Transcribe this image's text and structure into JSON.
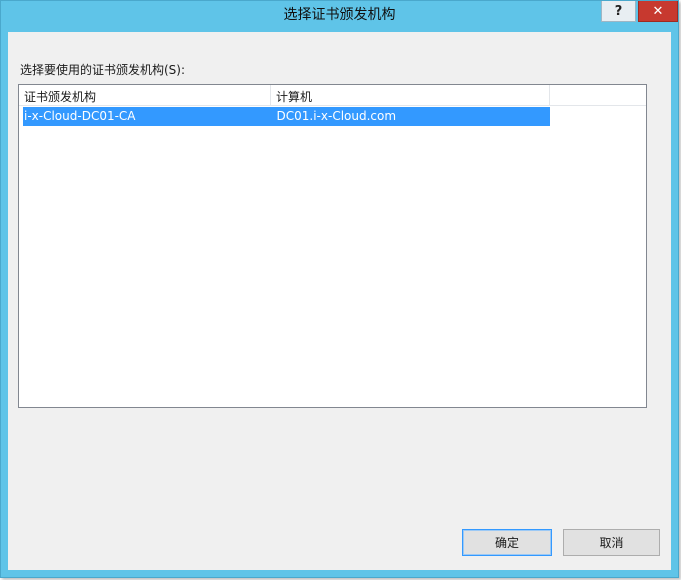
{
  "window": {
    "title": "选择证书颁发机构",
    "help_label": "?",
    "close_label": "✕"
  },
  "dialog": {
    "prompt": "选择要使用的证书颁发机构(S):"
  },
  "list": {
    "columns": [
      "证书颁发机构",
      "计算机",
      ""
    ],
    "rows": [
      {
        "ca": "i-x-Cloud-DC01-CA",
        "computer": "DC01.i-x-Cloud.com",
        "selected": true
      }
    ]
  },
  "buttons": {
    "ok": "确定",
    "cancel": "取消"
  },
  "colors": {
    "titlebar": "#5fc4e8",
    "selection": "#3399ff",
    "close": "#c7392f"
  }
}
